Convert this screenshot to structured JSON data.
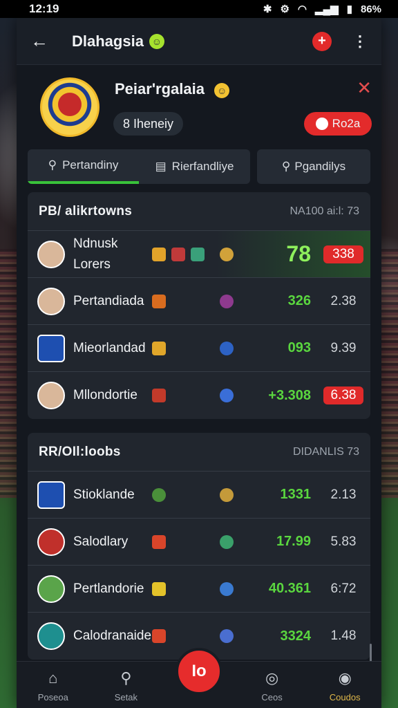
{
  "status": {
    "time": "12:19",
    "icons": [
      "bluetooth-icon",
      "settings-icon",
      "wifi-icon",
      "signal-icon",
      "battery-icon"
    ],
    "battery": "86%"
  },
  "header": {
    "title": "Dlahagsia"
  },
  "profile": {
    "name": "Peiar'rgalaia",
    "chip": "8 Iheneiy",
    "live_label": "Ro2a"
  },
  "tabs": {
    "tab1": "Pertandiny",
    "tab2": "Rierfandliye",
    "tab3": "Pgandilys"
  },
  "section1": {
    "title": "PB/ alikrtowns",
    "meta": "NA100 ai:l: 73",
    "rows": [
      {
        "name": "Ndnusk Lorers",
        "score": "78",
        "odd": "338",
        "highlight": true,
        "odd_red": true
      },
      {
        "name": "Pertandiada",
        "score": "326",
        "odd": "2.38",
        "highlight": false,
        "odd_red": false
      },
      {
        "name": "Mieorlandad",
        "score": "093",
        "odd": "9.39",
        "highlight": false,
        "odd_red": false
      },
      {
        "name": "Mllondortie",
        "score": "+3.308",
        "odd": "6.38",
        "highlight": false,
        "odd_red": true
      }
    ]
  },
  "section2": {
    "title": "RR/OIl:loobs",
    "meta": "DIDANLIS 73",
    "rows": [
      {
        "name": "Stioklande",
        "score": "1331",
        "odd": "2.13"
      },
      {
        "name": "Salodlary",
        "score": "17.99",
        "odd": "5.83"
      },
      {
        "name": "Pertlandorie",
        "score": "40.361",
        "odd": "6:72"
      },
      {
        "name": "Calodranaide",
        "score": "3324",
        "odd": "1.48"
      }
    ]
  },
  "nav": {
    "home": "Poseoa",
    "search": "Setak",
    "fab": "Io",
    "games": "Ceos",
    "profile": "Coudos"
  },
  "colors": {
    "accent_green": "#39c23a",
    "accent_red": "#e32b2b"
  }
}
